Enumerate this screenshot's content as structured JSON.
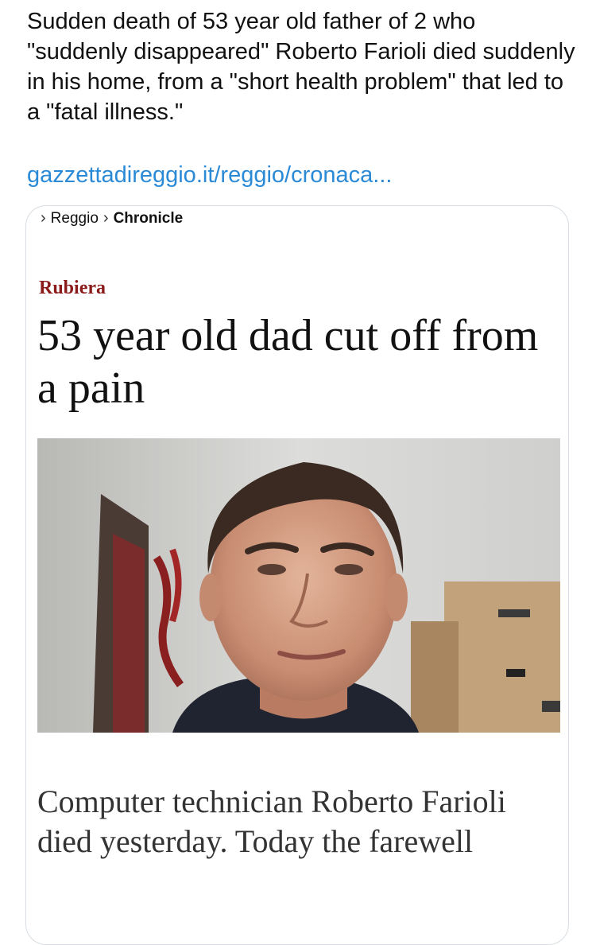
{
  "tweet": {
    "text": "Sudden death of 53 year old father of 2 who \"suddenly disappeared\" Roberto Farioli died suddenly in his home, from a \"short health problem\" that led to a \"fatal illness.\"",
    "link": "gazzettadireggio.it/reggio/cronaca..."
  },
  "card": {
    "breadcrumb": {
      "items": [
        "Reggio",
        "Chronicle"
      ]
    },
    "kicker": "Rubiera",
    "headline": "53 year old dad cut off from a pain",
    "subheadline": "Computer technician Roberto Farioli died yesterday. Today the farewell",
    "photo": {
      "subject": "portrait-photo"
    }
  },
  "colors": {
    "link": "#2b8ad6",
    "kicker": "#8b1a1a",
    "card_border": "#d7dde2"
  }
}
